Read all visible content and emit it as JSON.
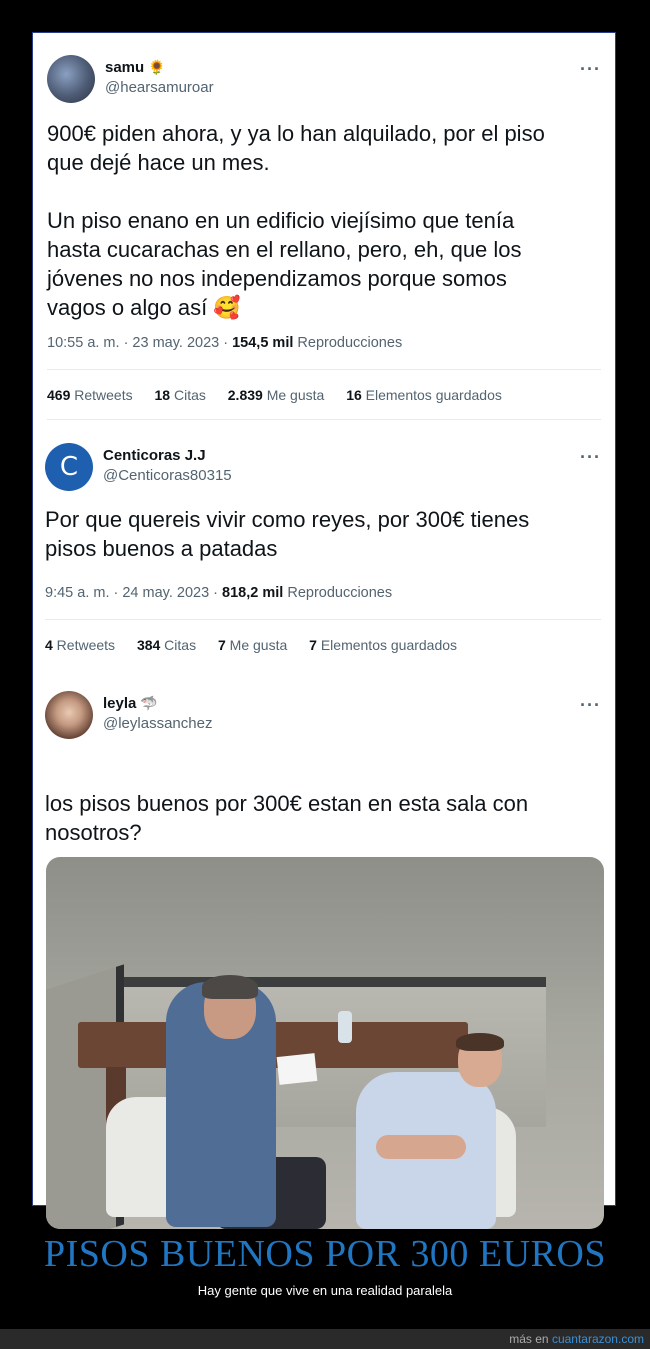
{
  "tweets": [
    {
      "name": "samu",
      "name_emoji": "🌻",
      "handle": "@hearsamuroar",
      "text": "900€ piden ahora, y ya lo han alquilado, por el piso\nque dejé hace un mes.\n\nUn piso enano en un edificio viejísimo que tenía\nhasta cucarachas en el rellano, pero, eh, que los\njóvenes no nos independizamos porque somos\nvagos o algo así 🥰",
      "time": "10:55 a. m. · 23 may. 2023 · ",
      "views": "154,5 mil",
      "views_label": " Reproducciones",
      "stats": [
        {
          "count": "469",
          "label": " Retweets"
        },
        {
          "count": "18",
          "label": " Citas"
        },
        {
          "count": "2.839",
          "label": " Me gusta"
        },
        {
          "count": "16",
          "label": " Elementos guardados"
        }
      ]
    },
    {
      "name": "Centicoras J.J",
      "avatar_letter": "C",
      "handle": "@Centicoras80315",
      "text": "Por que quereis vivir como reyes, por 300€ tienes\npisos buenos a patadas",
      "time": "9:45 a. m. · 24 may. 2023 · ",
      "views": "818,2 mil",
      "views_label": " Reproducciones",
      "stats": [
        {
          "count": "4",
          "label": " Retweets"
        },
        {
          "count": "384",
          "label": " Citas"
        },
        {
          "count": "7",
          "label": " Me gusta"
        },
        {
          "count": "7",
          "label": " Elementos guardados"
        }
      ]
    },
    {
      "name": "leyla",
      "name_emoji": "🦈",
      "handle": "@leylassanchez",
      "text": "los pisos buenos por 300€ estan en esta sala con\nnosotros?"
    }
  ],
  "more_icon": "···",
  "headline": "PISOS BUENOS POR 300 EUROS",
  "subheadline": "Hay gente que vive en una realidad paralela",
  "footer": {
    "prefix": "más en ",
    "link": "cuantarazon.com"
  },
  "colors": {
    "headline": "#2176c2",
    "link": "#3a8fd6",
    "frame": "#2a3d8f"
  }
}
